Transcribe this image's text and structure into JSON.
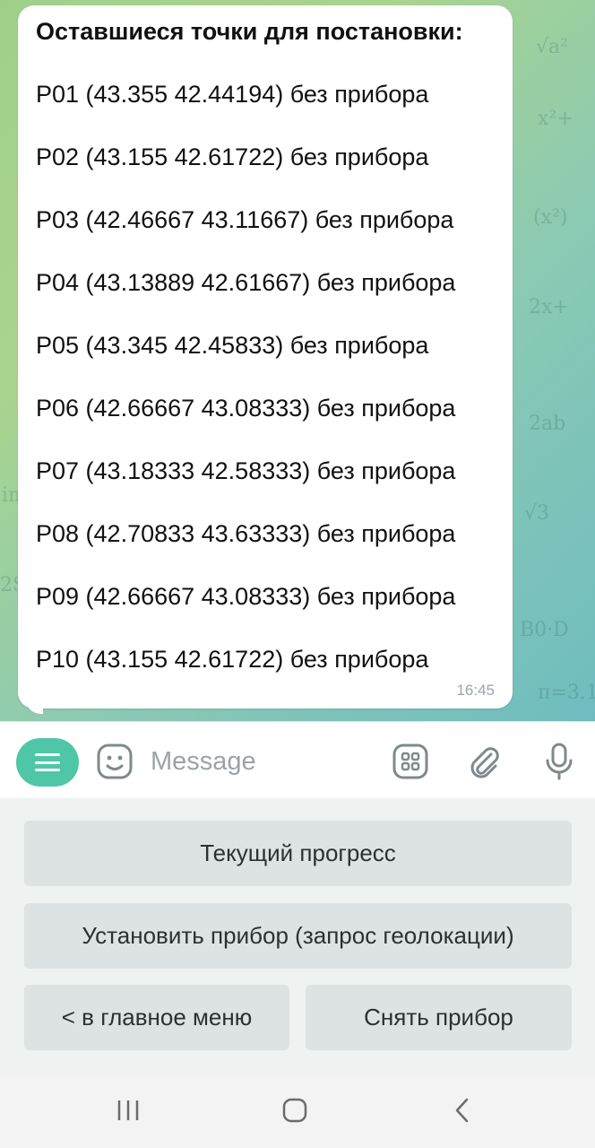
{
  "message": {
    "title": "Оставшиеся точки для постановки:",
    "lines": [
      "P01 (43.355 42.44194) без прибора",
      "P02 (43.155 42.61722) без прибора",
      "P03 (42.46667 43.11667) без прибора",
      "P04 (43.13889 42.61667) без прибора",
      "P05 (43.345 42.45833) без прибора",
      "P06 (42.66667 43.08333) без прибора",
      "P07 (43.18333 42.58333) без прибора",
      "P08 (42.70833 43.63333) без прибора",
      "P09 (42.66667 43.08333) без прибора",
      "P10 (43.155 42.61722) без прибора"
    ],
    "time": "16:45"
  },
  "input": {
    "placeholder": "Message"
  },
  "keyboard": {
    "progress": "Текущий прогресс",
    "install": "Установить прибор (запрос геолокации)",
    "main_menu": "< в главное меню",
    "remove": "Снять прибор"
  },
  "icons": {
    "menu": "menu-icon",
    "emoji": "emoji-icon",
    "apps": "apps-icon",
    "attach": "attach-icon",
    "mic": "mic-icon",
    "recents": "recents-icon",
    "home": "home-icon",
    "back": "back-icon"
  },
  "colors": {
    "accent": "#4fc7a6",
    "bubble": "#ffffff",
    "keyboard_button": "#dde3e2"
  }
}
